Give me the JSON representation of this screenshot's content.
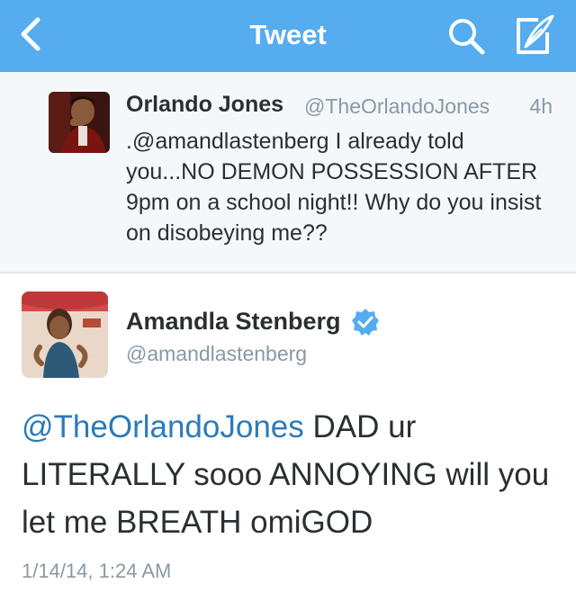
{
  "navbar": {
    "title": "Tweet",
    "icons": [
      "back-chevron-icon",
      "search-icon",
      "compose-tweet-icon"
    ],
    "background": "#55acee"
  },
  "parent_tweet": {
    "name": "Orlando Jones",
    "handle": "@TheOrlandoJones",
    "time": "4h",
    "text": ".@amandlastenberg I already told you...NO DEMON POSSESSION AFTER 9pm on a school night!! Why do you insist on disobeying me??"
  },
  "main_tweet": {
    "name": "Amandla Stenberg",
    "verified": true,
    "handle": "@amandlastenberg",
    "mention": "@TheOrlandoJones",
    "text": " DAD ur LITERALLY sooo ANNOYING will you let me BREATH omiGOD",
    "timestamp": "1/14/14, 1:24 AM"
  },
  "colors": {
    "link": "#2b7bb9",
    "text": "#292f33",
    "secondary": "#8899a6",
    "verified": "#55acee"
  }
}
